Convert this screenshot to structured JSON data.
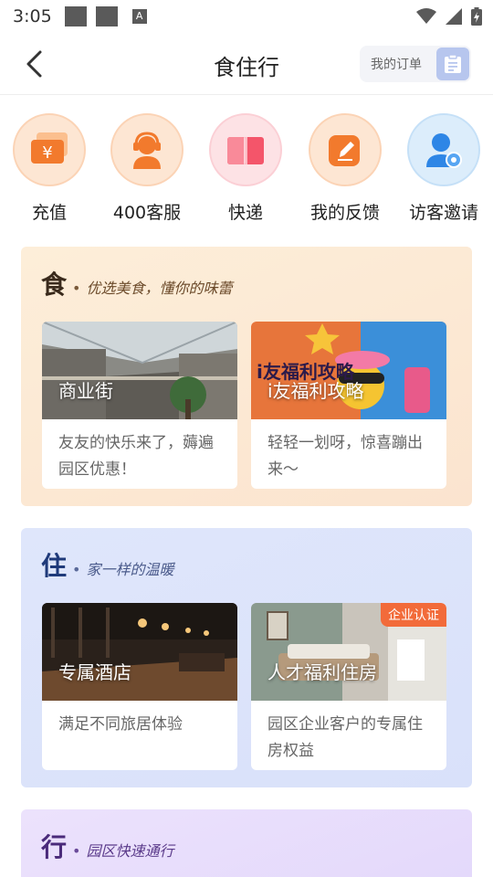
{
  "status": {
    "time": "3:05",
    "a_label": "A"
  },
  "header": {
    "title": "食住行",
    "orders_label": "我的订单"
  },
  "quick": [
    {
      "label": "充值",
      "icon": "yuan-wallet-icon"
    },
    {
      "label": "400客服",
      "icon": "headset-agent-icon"
    },
    {
      "label": "快递",
      "icon": "parcel-box-icon"
    },
    {
      "label": "我的反馈",
      "icon": "edit-feedback-icon"
    },
    {
      "label": "访客邀请",
      "icon": "visitor-invite-icon"
    }
  ],
  "sections": {
    "food": {
      "char": "食",
      "dot": "•",
      "subtitle": "优选美食，懂你的味蕾",
      "cards": [
        {
          "title": "商业街",
          "desc": "友友的快乐来了，薅遍园区优惠！"
        },
        {
          "title": "i友福利攻略",
          "desc": "轻轻一划呀，惊喜蹦出来～",
          "art_text": "i友福利攻略"
        }
      ]
    },
    "stay": {
      "char": "住",
      "dot": "•",
      "subtitle": "家一样的温暖",
      "cards": [
        {
          "title": "专属酒店",
          "desc": "满足不同旅居体验"
        },
        {
          "title": "人才福利住房",
          "desc": "园区企业客户的专属住房权益",
          "badge": "企业认证"
        }
      ]
    },
    "travel": {
      "char": "行",
      "dot": "•",
      "subtitle": "园区快速通行"
    }
  },
  "colors": {
    "food_bg": "#fdebd5",
    "stay_bg": "#dfe6fb",
    "travel_bg": "#e9ddfb",
    "badge": "#f26b3a"
  }
}
